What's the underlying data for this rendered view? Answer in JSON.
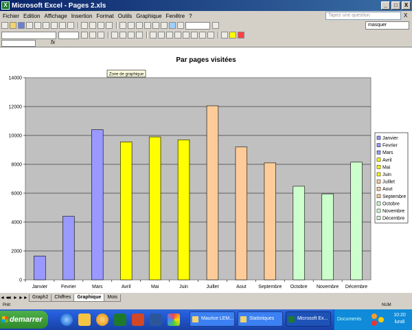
{
  "window": {
    "title": "Microsoft Excel - Pages 2.xls",
    "controls": [
      "_",
      "□",
      "X"
    ]
  },
  "menu": {
    "items": [
      "Fichier",
      "Edition",
      "Affichage",
      "Insertion",
      "Format",
      "Outils",
      "Graphique",
      "Fenêtre",
      "?"
    ],
    "help_placeholder": "Tapez une question",
    "doc_close": "X"
  },
  "toolbar": {
    "masquer": "masquer"
  },
  "formula": {
    "fx": "fx"
  },
  "chart_data": {
    "type": "bar",
    "title": "Par pages visitées",
    "tooltip": "Zone de graphique",
    "categories": [
      "Janvier",
      "Fevrier",
      "Mars",
      "Avril",
      "Mai",
      "Juin",
      "Juillet",
      "Aout",
      "Septembre",
      "Octobre",
      "Novembre",
      "Décembre"
    ],
    "values": [
      1650,
      4400,
      10400,
      9550,
      9900,
      9700,
      12050,
      9200,
      8100,
      6480,
      5950,
      8150
    ],
    "colors": [
      "#9999ff",
      "#9999ff",
      "#9999ff",
      "#ffff00",
      "#ffff00",
      "#ffff00",
      "#ffcc99",
      "#ffcc99",
      "#ffcc99",
      "#ccffcc",
      "#ccffcc",
      "#ccffcc"
    ],
    "ylim": [
      0,
      14000
    ],
    "yticks": [
      "0",
      "2000",
      "4000",
      "6000",
      "8000",
      "10000",
      "12000",
      "14000"
    ],
    "plot_background": "#c0c0c0",
    "grid": true,
    "legend_position": "right",
    "legend": [
      "Janvier",
      "Fevrier",
      "Mars",
      "Avril",
      "Mai",
      "Juin",
      "Juillet",
      "Aout",
      "Septembre",
      "Octobre",
      "Novembre",
      "Décembre"
    ]
  },
  "sheets": {
    "tabs": [
      "Graph2",
      "Chiffres",
      "Graphique",
      "Mois"
    ],
    "active": "Graphique",
    "nav": [
      "◄◄",
      "◄",
      "►",
      "►►"
    ]
  },
  "status": {
    "ready": "Prêt",
    "num": "NUM"
  },
  "taskbar": {
    "start": "demarrer",
    "tasks": [
      "Maurice LEM...",
      "Statistiques",
      "Microsoft Ex..."
    ],
    "tray_docs": "Documents",
    "time": "10:20",
    "day": "lundi"
  }
}
